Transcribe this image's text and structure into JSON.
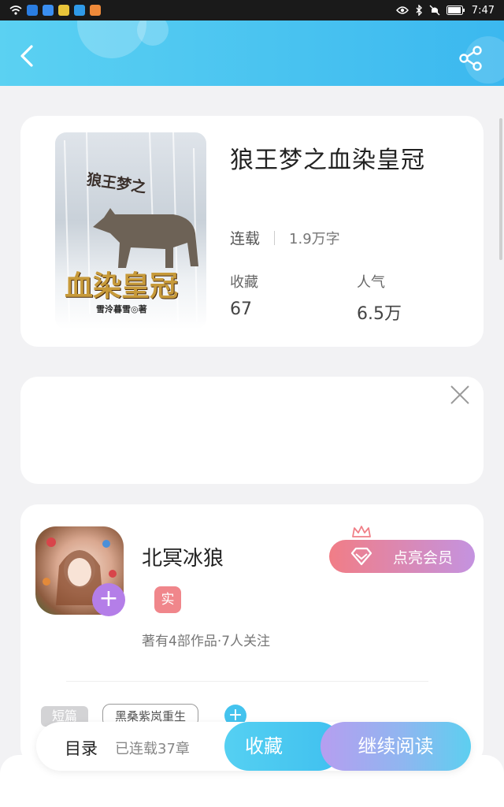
{
  "status_bar": {
    "time": "7:47"
  },
  "book": {
    "title": "狼王梦之血染皇冠",
    "status": "连载",
    "word_count": "1.9万字",
    "favorites_label": "收藏",
    "favorites_value": "67",
    "popularity_label": "人气",
    "popularity_value": "6.5万",
    "cover_text_top": "狼王梦之",
    "cover_text_main": "血染皇冠",
    "cover_text_author": "雪泠暮雪◎著"
  },
  "author": {
    "name": "北冥冰狼",
    "badge": "实",
    "summary": "著有4部作品·7人关注",
    "vip_label": "点亮会员"
  },
  "tags": {
    "first": "短篇",
    "second": "黑桑紫岚重生"
  },
  "bottom": {
    "toc_label": "目录",
    "chapters_label": "已连载37章",
    "collect_label": "收藏",
    "read_label": "继续阅读"
  },
  "colors": {
    "header": "#3bb8ef",
    "vip_start": "#f17d86",
    "vip_end": "#c493e0",
    "accent": "#44c3ee"
  }
}
